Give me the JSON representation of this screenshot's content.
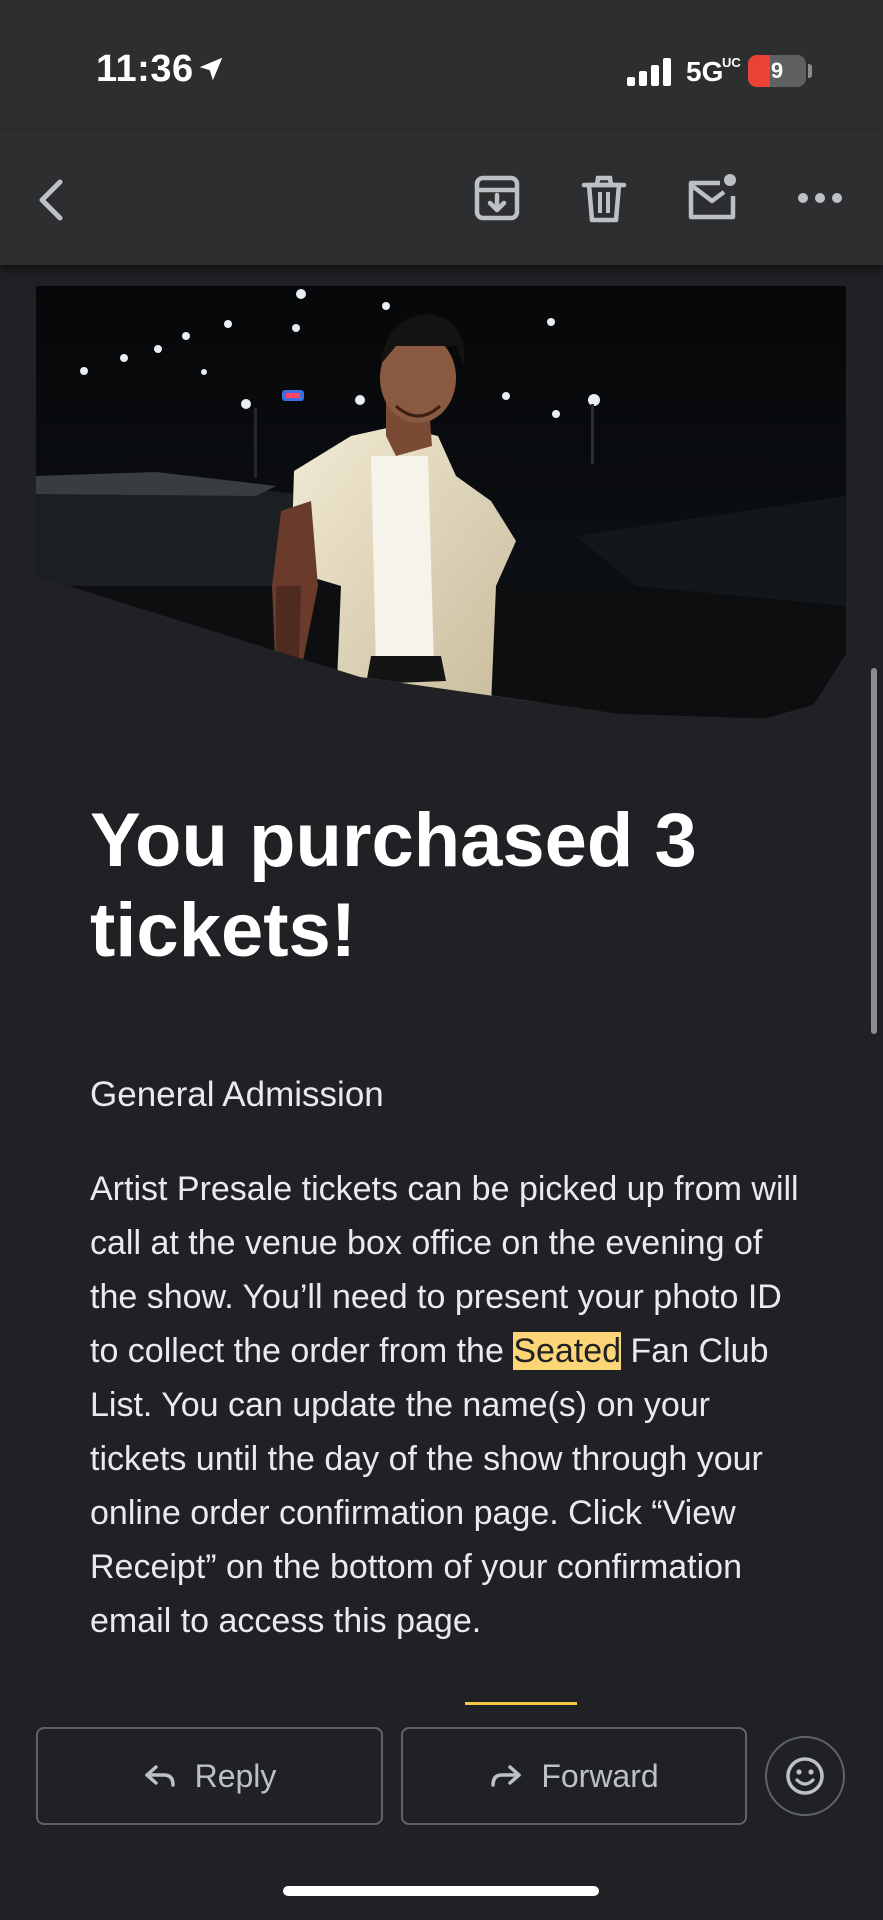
{
  "status_bar": {
    "time": "11:36",
    "network": "5G",
    "network_superscript": "UC",
    "battery_level": "9",
    "battery_fraction": 0.09,
    "signal_bars": 4
  },
  "toolbar": {
    "back_icon": "chevron-left-icon",
    "archive_icon": "archive-icon",
    "delete_icon": "trash-icon",
    "unread_icon": "mail-unread-icon",
    "more_icon": "more-horizontal-icon"
  },
  "email": {
    "heading": "You purchased 3 tickets!",
    "ticket_type": "General Admission",
    "body_before_highlight": "Artist Presale tickets can be picked up from will call at the venue box office on the evening of the show. You’ll need to present your photo ID to collect the order from the ",
    "body_highlight": "Seated",
    "body_after_highlight": " Fan Club List. You can update the name(s) on your tickets until the day of the show through your online order confirmation page. Click “View Receipt” on the bottom of your confirmation email to access this page."
  },
  "actions": {
    "reply_label": "Reply",
    "forward_label": "Forward",
    "emoji_icon": "add-reaction-icon"
  },
  "colors": {
    "background": "#202124",
    "toolbar": "#2d2e30",
    "highlight": "#fcd577",
    "battery_low": "#ea4335",
    "outline": "#5f6368"
  }
}
